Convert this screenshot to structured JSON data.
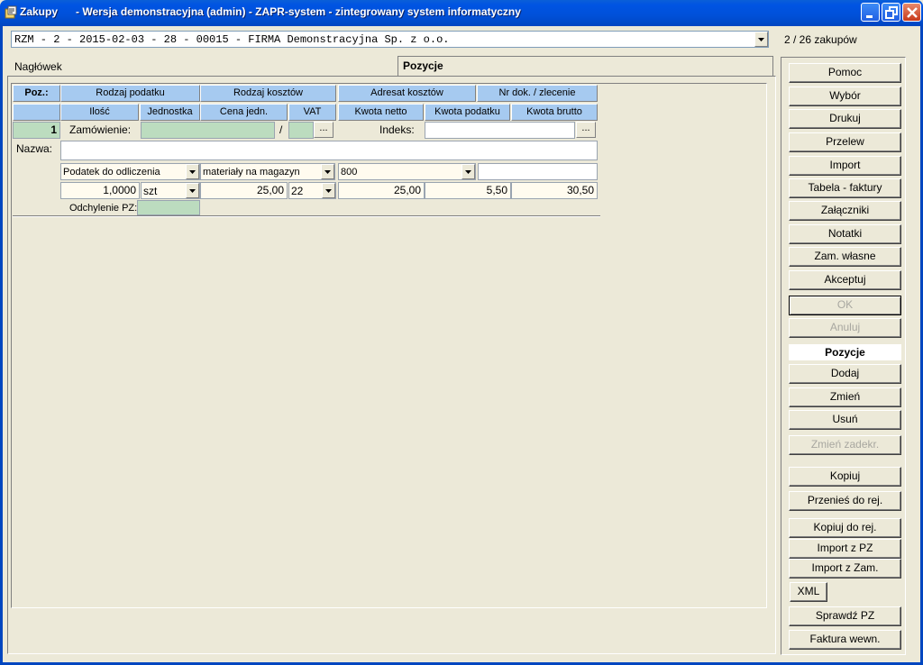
{
  "window": {
    "title": "Zakupy      - Wersja demonstracyjna (admin) - ZAPR-system - zintegrowany system informatyczny"
  },
  "document": {
    "selected": "RZM - 2 - 2015-02-03 - 28 - 00015 - FIRMA Demonstracyjna Sp. z o.o.",
    "counter": "2 / 26 zakupów"
  },
  "tabs": {
    "header": "Nagłówek",
    "items": "Pozycje"
  },
  "grid": {
    "headers_row1": [
      "Poz.:",
      "Rodzaj podatku",
      "Rodzaj kosztów",
      "Adresat kosztów",
      "Nr dok. / zlecenie"
    ],
    "headers_row2": [
      "",
      "Ilość",
      "Jednostka",
      "Cena jedn.",
      "VAT",
      "Kwota netto",
      "Kwota podatku",
      "Kwota brutto"
    ]
  },
  "item": {
    "position": "1",
    "order_label": "Zamówienie:",
    "order_value": "",
    "slash": "/",
    "order_suffix": "",
    "ellipsis": "...",
    "index_label": "Indeks:",
    "index_value": "",
    "name_label": "Nazwa:",
    "name_value": "",
    "tax_type": "Podatek do odliczenia",
    "cost_type": "materiały na magazyn",
    "cost_recipient": "800",
    "doc_number": "",
    "quantity": "1,0000",
    "unit": "szt",
    "unit_price": "25,00",
    "vat": "22",
    "net": "25,00",
    "tax": "5,50",
    "gross": "30,50",
    "deviation_label": "Odchylenie PZ:",
    "deviation_value": ""
  },
  "buttons": {
    "help": "Pomoc",
    "select": "Wybór",
    "print": "Drukuj",
    "transfer": "Przelew",
    "import": "Import",
    "invoice_table": "Tabela - faktury",
    "attachments": "Załączniki",
    "notes": "Notatki",
    "own_orders": "Zam. własne",
    "accept": "Akceptuj",
    "ok": "OK",
    "cancel": "Anuluj",
    "section_items": "Pozycje",
    "add": "Dodaj",
    "change": "Zmień",
    "delete": "Usuń",
    "change_posted": "Zmień zadekr.",
    "copy": "Kopiuj",
    "move_to_reg": "Przenieś do rej.",
    "copy_to_reg": "Kopiuj do rej.",
    "import_pz": "Import z PZ",
    "import_order": "Import z Zam.",
    "xml": "XML",
    "check_pz": "Sprawdź PZ",
    "internal_invoice": "Faktura wewn."
  }
}
